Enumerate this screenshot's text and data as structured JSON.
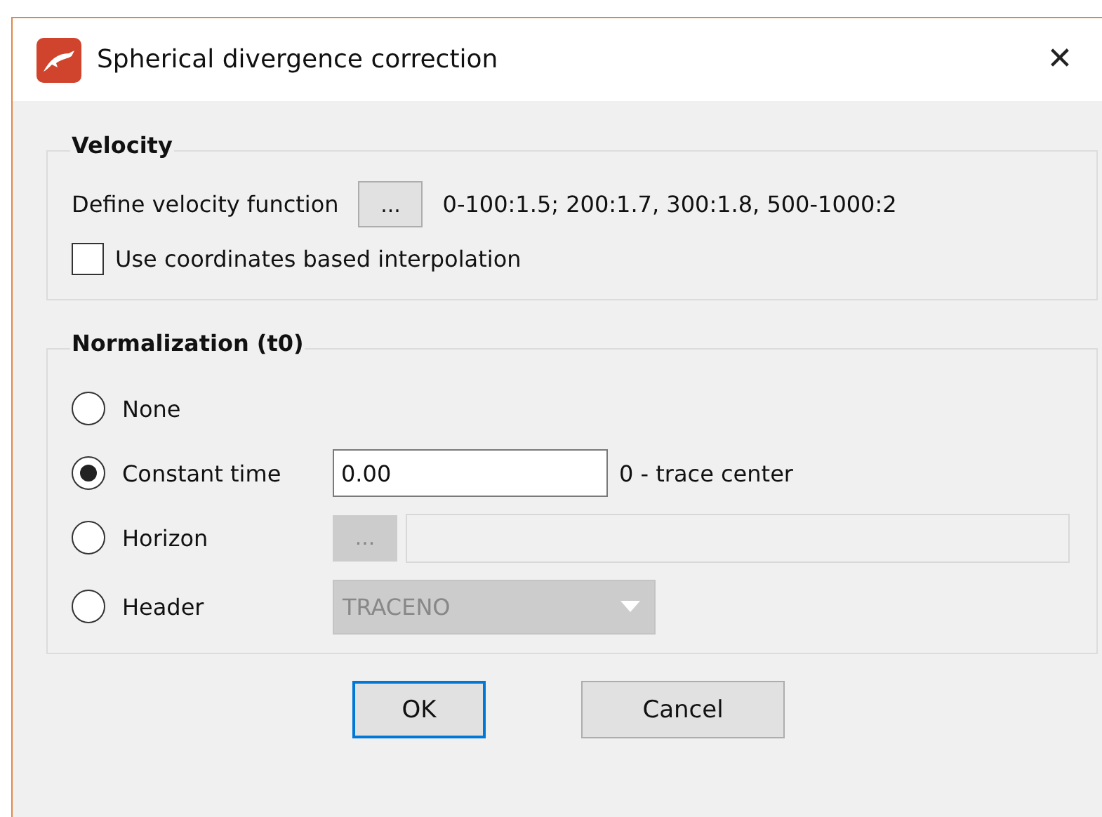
{
  "window": {
    "title": "Spherical divergence correction",
    "close": "✕"
  },
  "velocity": {
    "title": "Velocity",
    "label": "Define velocity function",
    "button": "...",
    "value": "0-100:1.5; 200:1.7, 300:1.8, 500-1000:2",
    "checkbox": {
      "label": "Use coordinates based interpolation",
      "checked": false
    }
  },
  "normalization": {
    "title": "Normalization (t0)",
    "options": [
      {
        "kind": "plain",
        "label": "None",
        "selected": false
      },
      {
        "kind": "input",
        "label": "Constant time",
        "selected": true,
        "value": "0.00",
        "note": "0 - trace center",
        "disabled": false
      },
      {
        "kind": "picker",
        "label": "Horizon",
        "selected": false,
        "button": "...",
        "disabled": true
      },
      {
        "kind": "dropdown",
        "label": "Header",
        "selected": false,
        "value": "TRACENO",
        "disabled": true
      }
    ]
  },
  "buttons": [
    {
      "label": "OK",
      "default": true
    },
    {
      "label": "Cancel",
      "default": false
    }
  ]
}
